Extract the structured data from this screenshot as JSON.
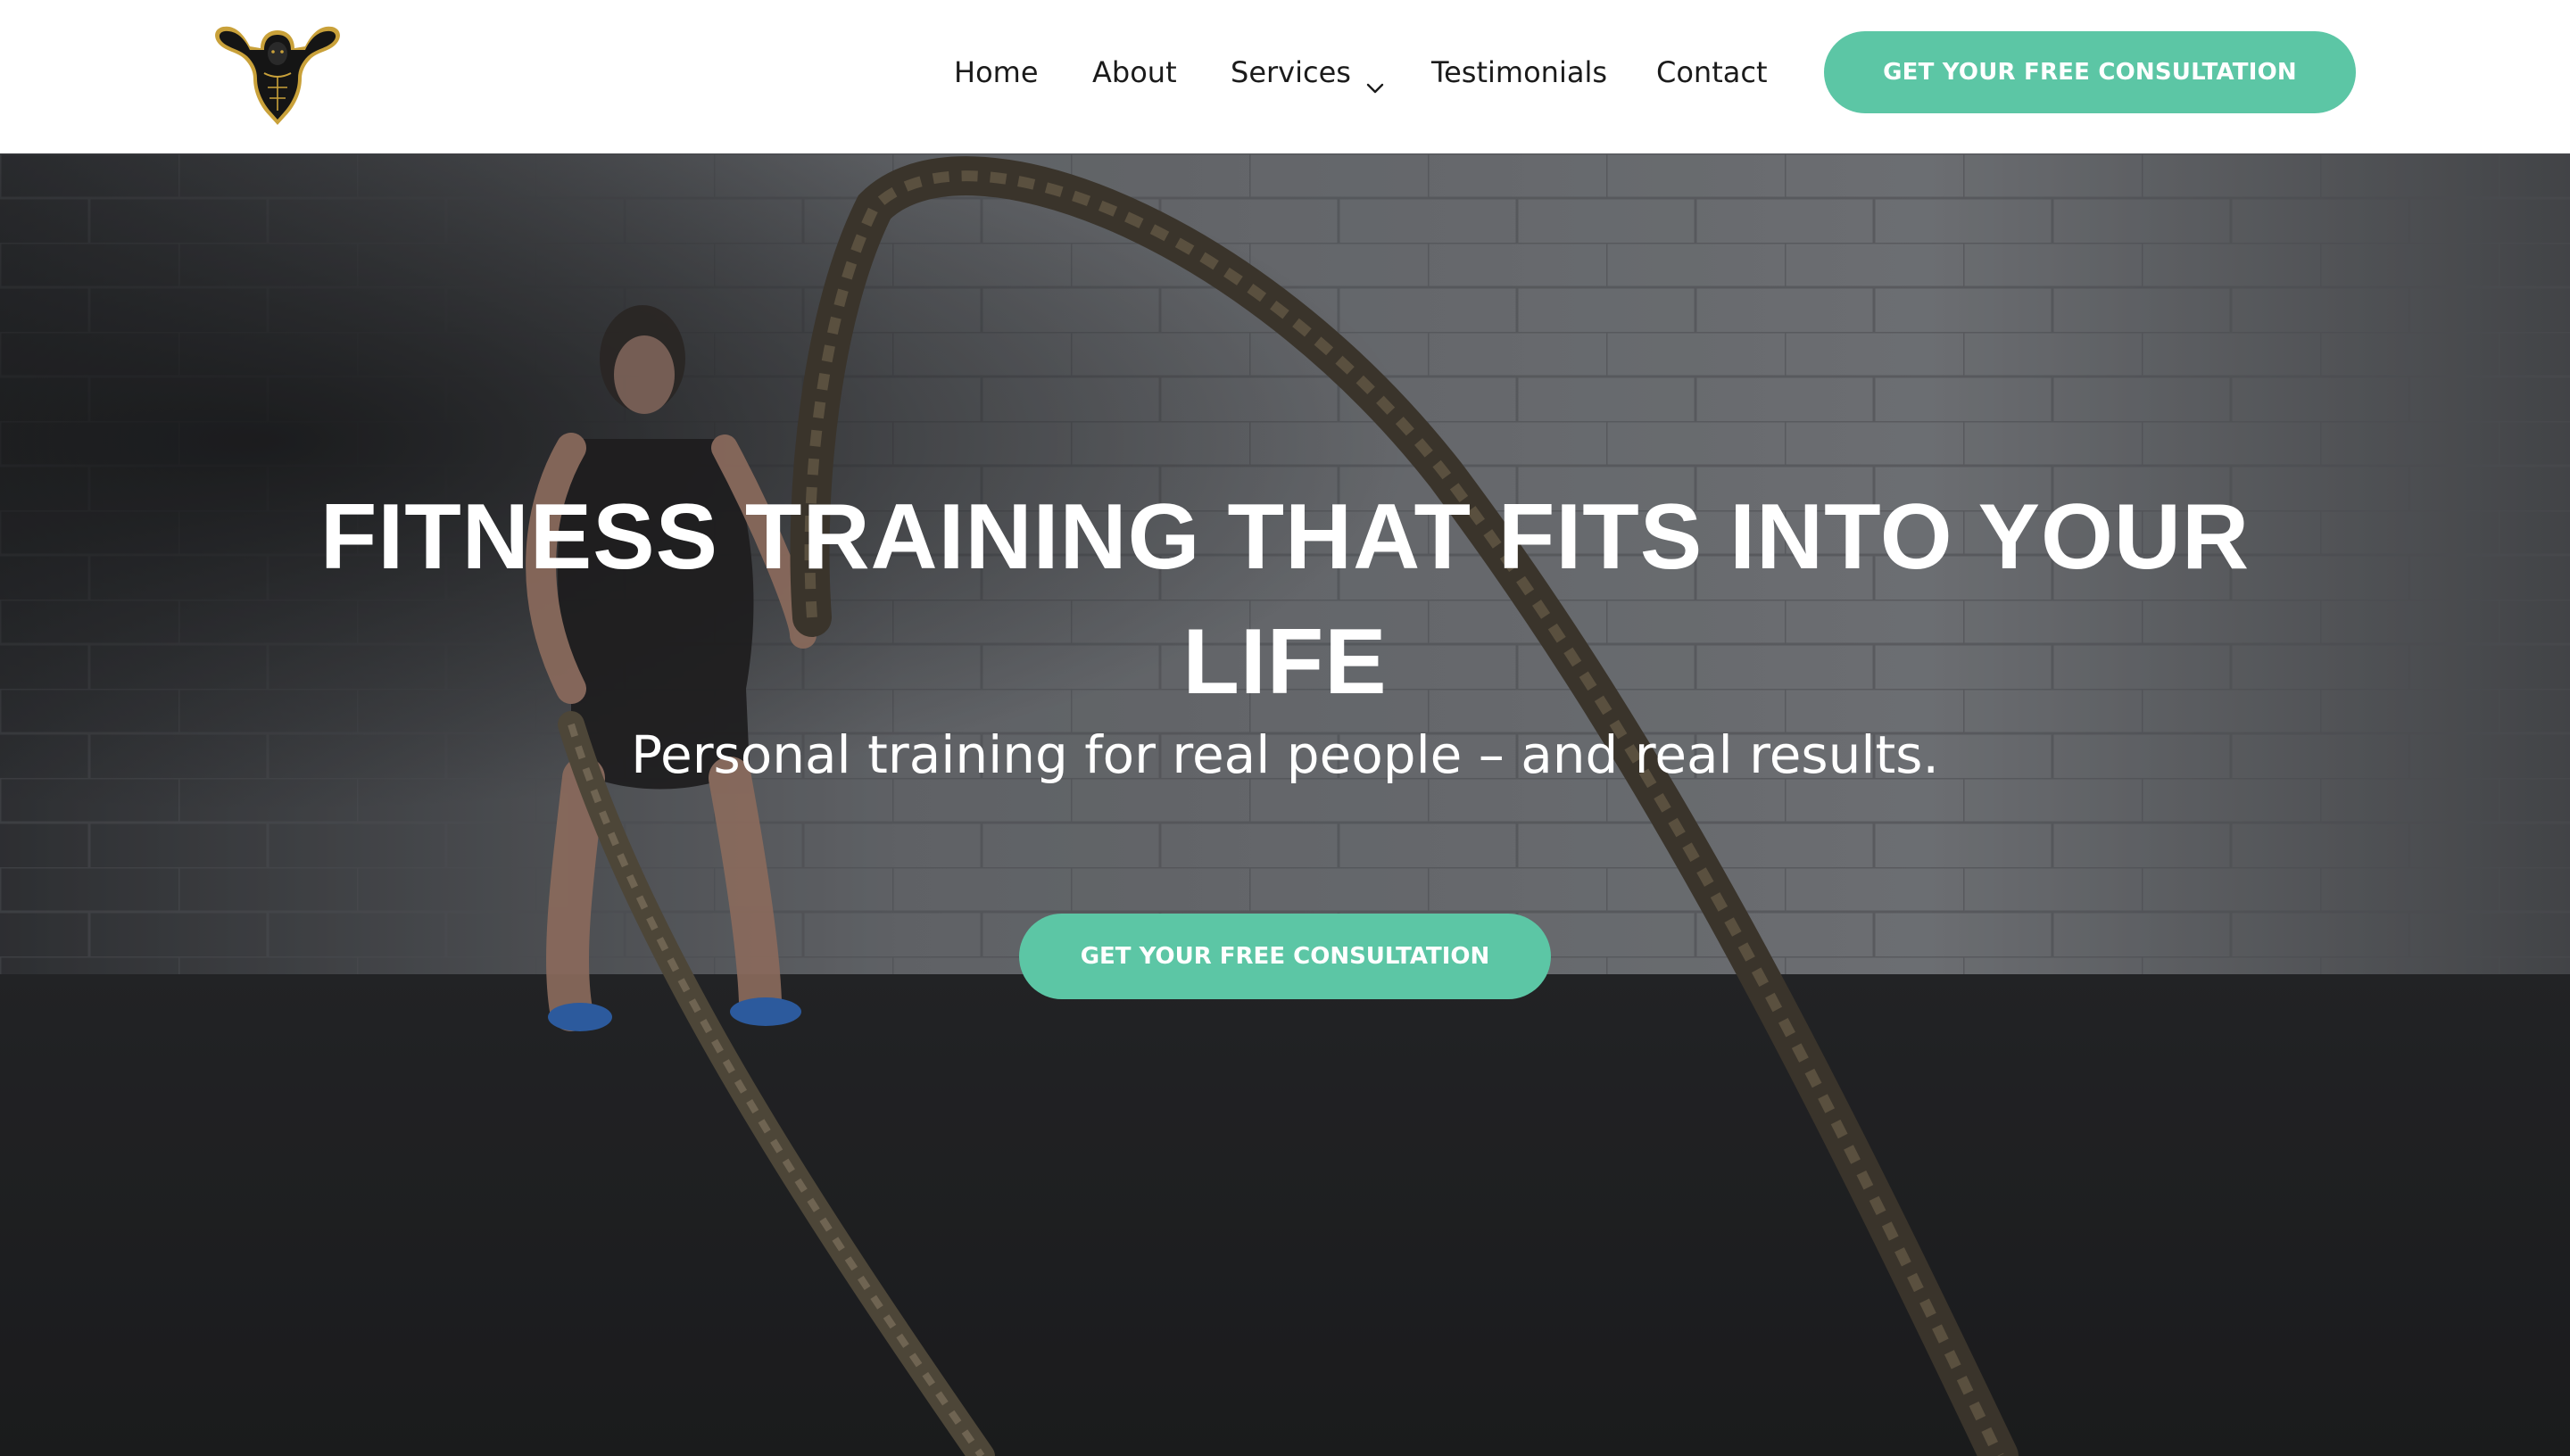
{
  "header": {
    "logo_icon": "muscle-man-logo",
    "nav": [
      {
        "label": "Home"
      },
      {
        "label": "About"
      },
      {
        "label": "Services",
        "icon": "chevron-down-icon"
      },
      {
        "label": "Testimonials"
      },
      {
        "label": "Contact"
      }
    ],
    "cta_label": "GET YOUR FREE CONSULTATION"
  },
  "hero": {
    "title": "FITNESS TRAINING THAT FITS INTO YOUR LIFE",
    "subtitle": "Personal training for real people – and real results.",
    "cta_label": "GET YOUR FREE CONSULTATION",
    "background": "person-with-battle-ropes-photo"
  },
  "colors": {
    "accent": "#5cc6a5",
    "header_bg": "#ffffff",
    "nav_text": "#1b1b1b",
    "hero_text": "#ffffff"
  }
}
